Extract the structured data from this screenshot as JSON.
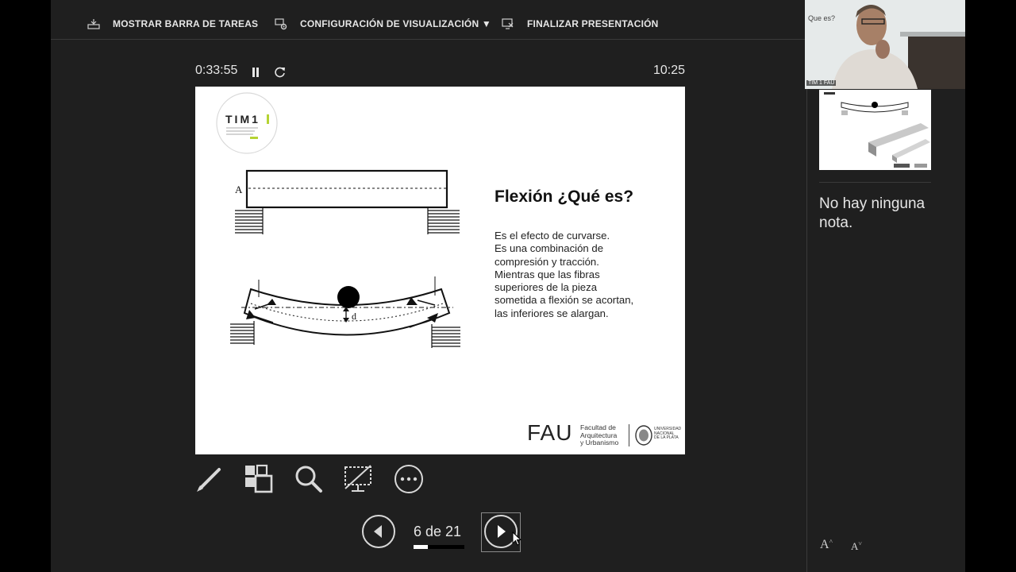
{
  "toolbar": {
    "taskbar_label": "MOSTRAR BARRA DE TAREAS",
    "display_settings_label": "CONFIGURACIÓN DE VISUALIZACIÓN ▼",
    "end_show_label": "FINALIZAR PRESENTACIÓN"
  },
  "timer": {
    "elapsed": "0:33:55",
    "clock": "10:25"
  },
  "slide": {
    "logo_text": "TIM1",
    "title": "Flexión ¿Qué es?",
    "body_lines": [
      "Es el efecto de curvarse.",
      "Es una combinación de",
      "compresión y tracción.",
      "Mientras que las fibras",
      "superiores de la pieza",
      "sometida a flexión se acortan,",
      "las inferiores se alargan."
    ],
    "diagram_label_a": "A",
    "diagram_label_d": "d",
    "footer_logo": "FAU",
    "footer_lines": [
      "Facultad de",
      "Arquitectura",
      "y Urbanismo"
    ],
    "university_lines": [
      "UNIVERSIDAD",
      "NACIONAL",
      "DE LA PLATA"
    ]
  },
  "navigation": {
    "slide_counter": "6 de 21",
    "progress_fraction": 0.286
  },
  "video": {
    "label": "TIM 1 FAU",
    "board_text": "Que es?"
  },
  "notes": {
    "text": "No hay ninguna nota."
  },
  "font_buttons": {
    "increase": "A",
    "decrease": "A"
  },
  "colors": {
    "app_bg": "#1f1f1f",
    "text": "#e6e6e6",
    "slide_bg": "#ffffff",
    "logo_accent": "#b5d333"
  },
  "icons": [
    "taskbar-icon",
    "display-settings-icon",
    "end-show-icon",
    "pause-icon",
    "restart-icon",
    "pen-icon",
    "slides-grid-icon",
    "zoom-icon",
    "black-screen-icon",
    "more-options-icon",
    "previous-icon",
    "next-icon",
    "increase-font-icon",
    "decrease-font-icon"
  ]
}
